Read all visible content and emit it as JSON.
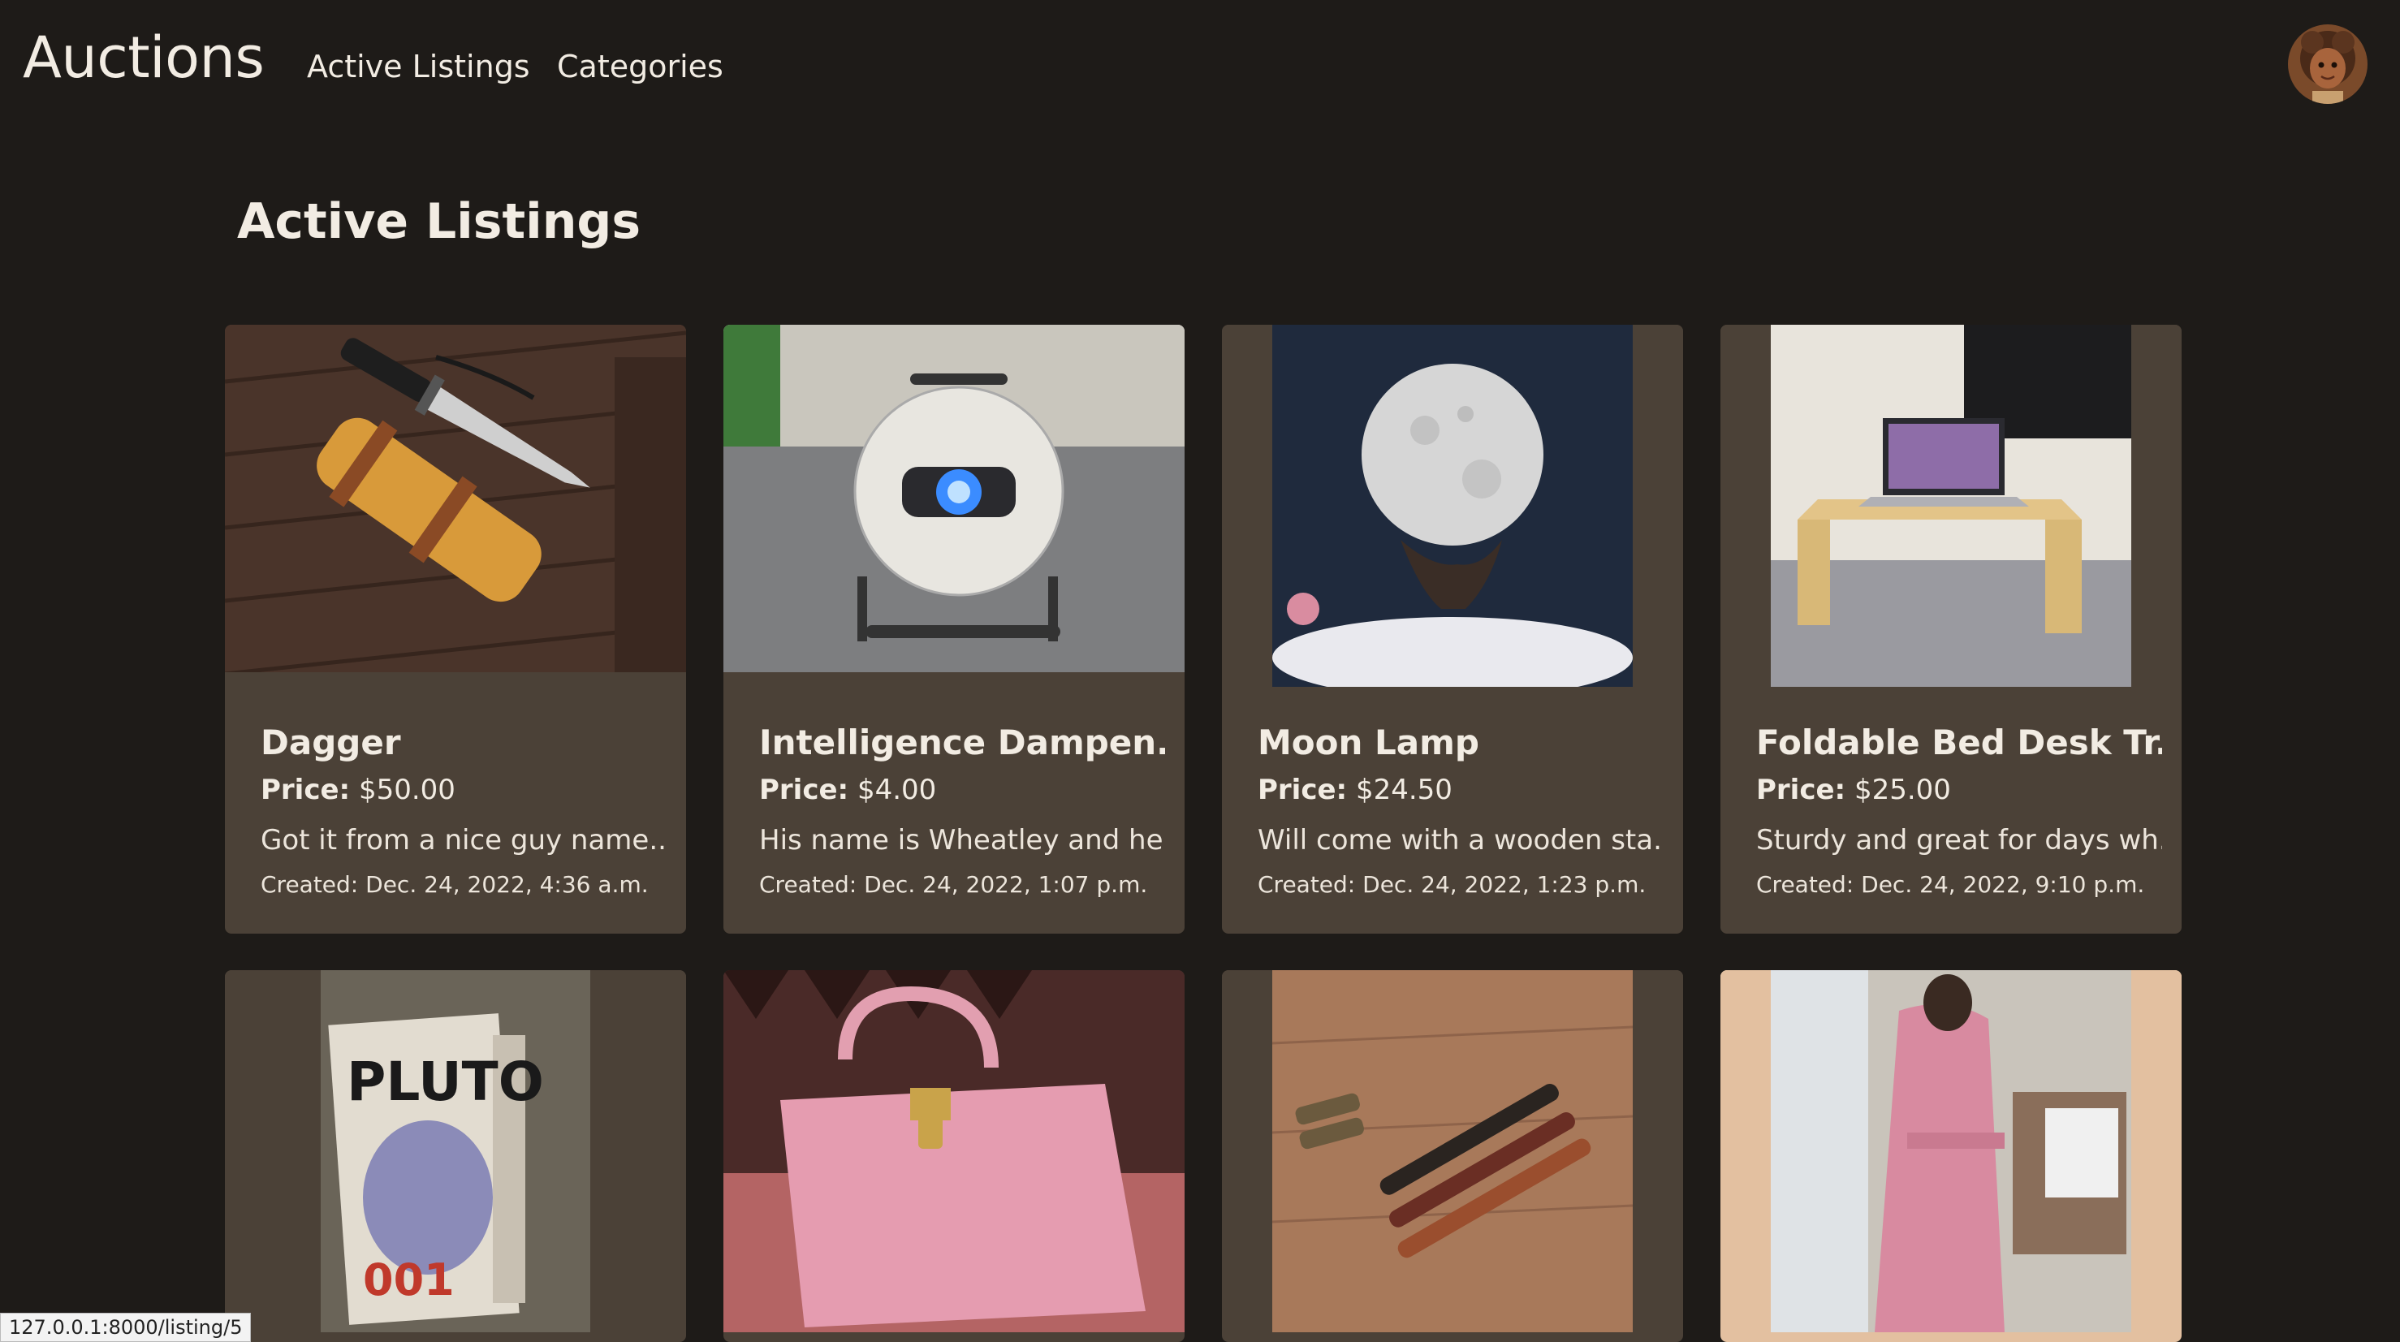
{
  "navbar": {
    "brand": "Auctions",
    "links": [
      "Active Listings",
      "Categories"
    ]
  },
  "page": {
    "title": "Active Listings"
  },
  "labels": {
    "price": "Price:"
  },
  "listings": [
    {
      "title": "Dagger",
      "price": "$50.00",
      "desc": "Got it from a nice guy name...",
      "created": "Created: Dec. 24, 2022, 4:36 a.m."
    },
    {
      "title": "Intelligence Dampen...",
      "price": "$4.00",
      "desc": "His name is Wheatley and he...",
      "created": "Created: Dec. 24, 2022, 1:07 p.m."
    },
    {
      "title": "Moon Lamp",
      "price": "$24.50",
      "desc": "Will come with a wooden sta...",
      "created": "Created: Dec. 24, 2022, 1:23 p.m."
    },
    {
      "title": "Foldable Bed Desk Tr...",
      "price": "$25.00",
      "desc": "Sturdy and great for days wh...",
      "created": "Created: Dec. 24, 2022, 9:10 p.m."
    }
  ],
  "status_bar": {
    "url": "127.0.0.1:8000/listing/5"
  },
  "colors": {
    "background": "#1e1b18",
    "card": "#4b4137",
    "text": "#f2ece3"
  }
}
